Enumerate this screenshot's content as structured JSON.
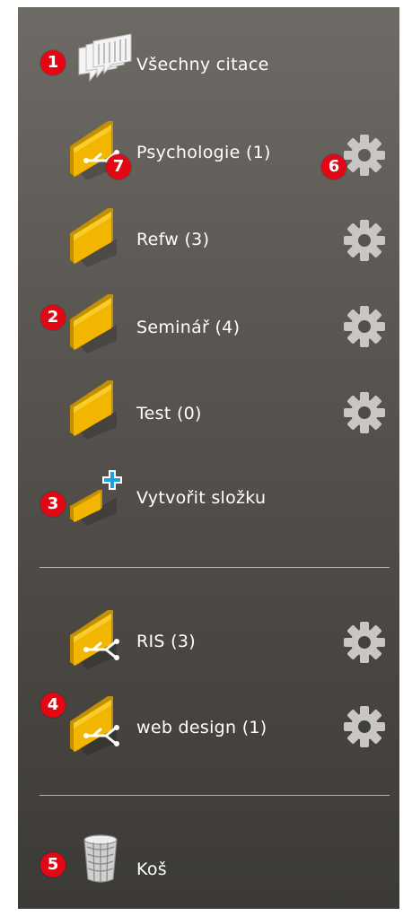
{
  "items": {
    "all": {
      "label": "Všechny citace"
    },
    "folders": [
      {
        "label": "Psychologie (1)",
        "shared": true
      },
      {
        "label": "Refw (3)",
        "shared": false
      },
      {
        "label": "Seminář (4)",
        "shared": false
      },
      {
        "label": "Test (0)",
        "shared": false
      }
    ],
    "create": {
      "label": "Vytvořit složku"
    },
    "shared_folders": [
      {
        "label": "RIS (3)"
      },
      {
        "label": "web design (1)"
      }
    ],
    "trash": {
      "label": "Koš"
    }
  },
  "markers": [
    "1",
    "2",
    "3",
    "4",
    "5",
    "6",
    "7"
  ],
  "colors": {
    "folder": "#f2b600",
    "marker": "#e30613",
    "plus": "#1e9fe0",
    "gear": "#c9c7c4"
  }
}
